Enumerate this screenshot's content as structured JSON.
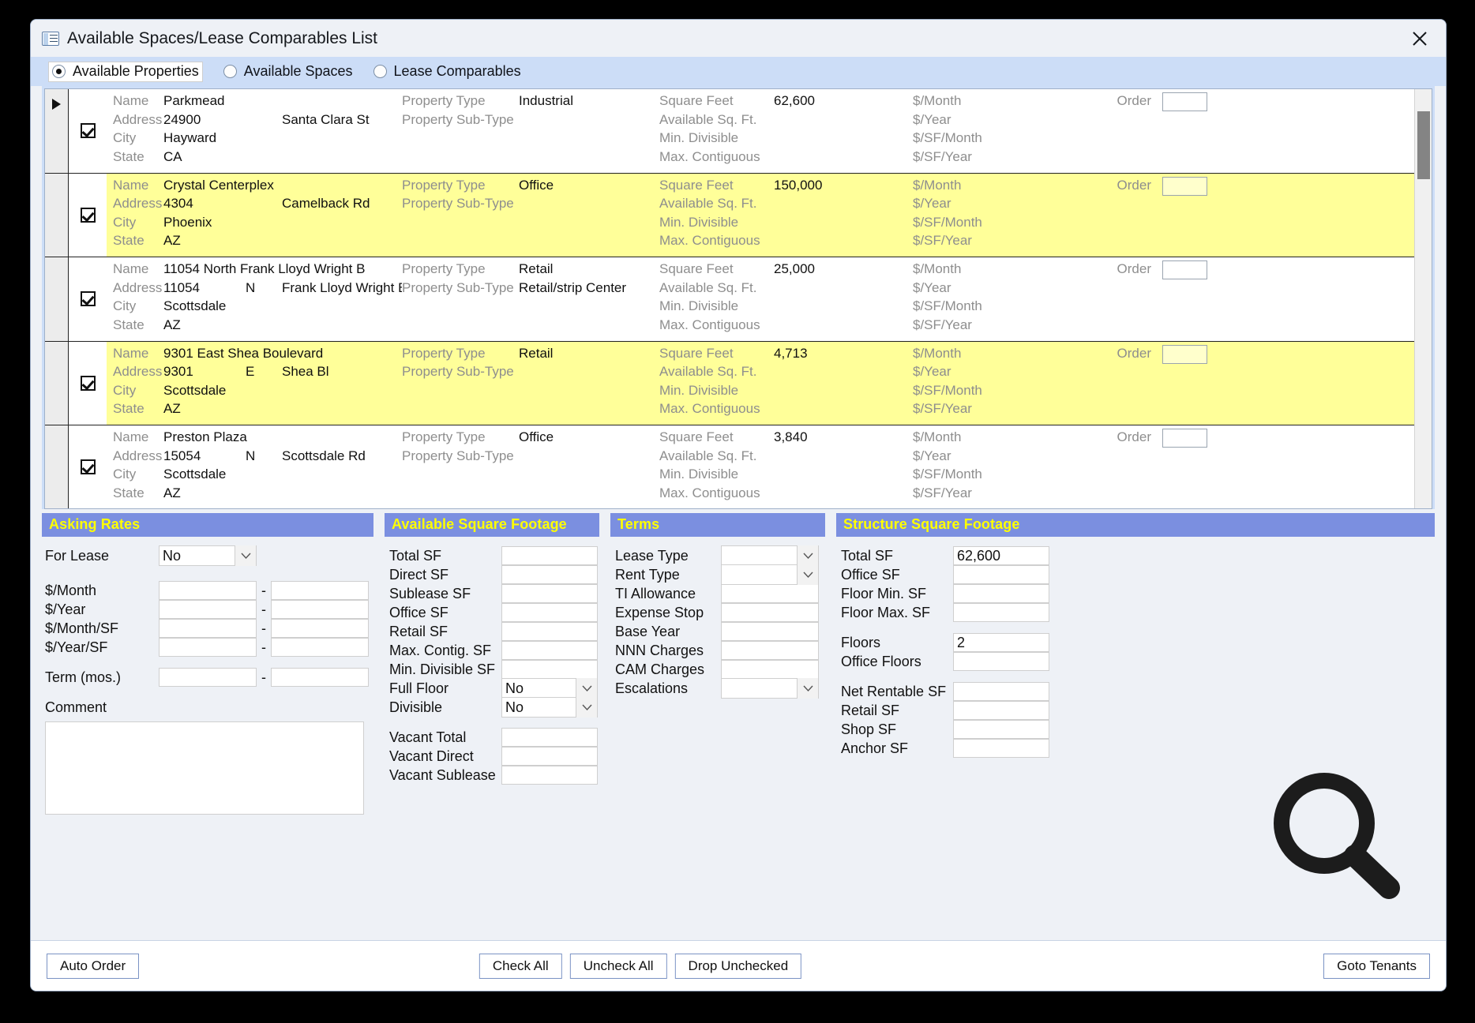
{
  "window": {
    "title": "Available Spaces/Lease Comparables List",
    "icon": "list-window-icon",
    "close_label": "✕"
  },
  "view_modes": {
    "options": [
      {
        "label": "Available Properties",
        "selected": true
      },
      {
        "label": "Available Spaces",
        "selected": false
      },
      {
        "label": "Lease Comparables",
        "selected": false
      }
    ]
  },
  "grid": {
    "field_labels": {
      "name": "Name",
      "address": "Address",
      "city": "City",
      "state": "State",
      "property_type": "Property Type",
      "property_sub_type": "Property Sub-Type",
      "square_feet": "Square Feet",
      "available_sq_ft": "Available Sq. Ft.",
      "min_divisible": "Min. Divisible",
      "max_contiguous": "Max. Contiguous",
      "per_month": "$/Month",
      "per_year": "$/Year",
      "per_sf_month": "$/SF/Month",
      "per_sf_year": "$/SF/Year",
      "order": "Order"
    },
    "rows": [
      {
        "current": true,
        "checked": true,
        "highlighted": false,
        "name": "Parkmead",
        "street_number": "24900",
        "street_dir": "",
        "street_name": "Santa Clara St",
        "city": "Hayward",
        "state": "CA",
        "property_type": "Industrial",
        "property_sub_type": "",
        "square_feet": "62,600",
        "available_sq_ft": "",
        "min_divisible": "",
        "max_contiguous": "",
        "per_month": "",
        "per_year": "",
        "per_sf_month": "",
        "per_sf_year": "",
        "order": ""
      },
      {
        "current": false,
        "checked": true,
        "highlighted": true,
        "name": "Crystal Centerplex",
        "street_number": "4304",
        "street_dir": "",
        "street_name": "Camelback Rd",
        "city": "Phoenix",
        "state": "AZ",
        "property_type": "Office",
        "property_sub_type": "",
        "square_feet": "150,000",
        "available_sq_ft": "",
        "min_divisible": "",
        "max_contiguous": "",
        "per_month": "",
        "per_year": "",
        "per_sf_month": "",
        "per_sf_year": "",
        "order": ""
      },
      {
        "current": false,
        "checked": true,
        "highlighted": false,
        "name": "11054 North Frank Lloyd Wright B",
        "street_number": "11054",
        "street_dir": "N",
        "street_name": "Frank Lloyd Wright B",
        "city": "Scottsdale",
        "state": "AZ",
        "property_type": "Retail",
        "property_sub_type": "Retail/strip Center",
        "square_feet": "25,000",
        "available_sq_ft": "",
        "min_divisible": "",
        "max_contiguous": "",
        "per_month": "",
        "per_year": "",
        "per_sf_month": "",
        "per_sf_year": "",
        "order": ""
      },
      {
        "current": false,
        "checked": true,
        "highlighted": true,
        "name": "9301 East Shea Boulevard",
        "street_number": "9301",
        "street_dir": "E",
        "street_name": "Shea Bl",
        "city": "Scottsdale",
        "state": "AZ",
        "property_type": "Retail",
        "property_sub_type": "",
        "square_feet": "4,713",
        "available_sq_ft": "",
        "min_divisible": "",
        "max_contiguous": "",
        "per_month": "",
        "per_year": "",
        "per_sf_month": "",
        "per_sf_year": "",
        "order": ""
      },
      {
        "current": false,
        "checked": true,
        "highlighted": false,
        "name": "Preston Plaza",
        "street_number": "15054",
        "street_dir": "N",
        "street_name": "Scottsdale Rd",
        "city": "Scottsdale",
        "state": "AZ",
        "property_type": "Office",
        "property_sub_type": "",
        "square_feet": "3,840",
        "available_sq_ft": "",
        "min_divisible": "",
        "max_contiguous": "",
        "per_month": "",
        "per_year": "",
        "per_sf_month": "",
        "per_sf_year": "",
        "order": ""
      }
    ]
  },
  "asking_rates": {
    "heading": "Asking Rates",
    "for_lease_label": "For Lease",
    "for_lease_value": "No",
    "per_month_label": "$/Month",
    "per_month_from": "",
    "per_month_to": "",
    "per_year_label": "$/Year",
    "per_year_from": "",
    "per_year_to": "",
    "per_month_sf_label": "$/Month/SF",
    "per_month_sf_from": "",
    "per_month_sf_to": "",
    "per_year_sf_label": "$/Year/SF",
    "per_year_sf_from": "",
    "per_year_sf_to": "",
    "term_label": "Term (mos.)",
    "term_from": "",
    "term_to": "",
    "comment_label": "Comment",
    "comment_value": "",
    "range_separator": "-"
  },
  "available_sf": {
    "heading": "Available Square Footage",
    "fields": [
      {
        "label": "Total SF",
        "value": "",
        "type": "text"
      },
      {
        "label": "Direct SF",
        "value": "",
        "type": "text"
      },
      {
        "label": "Sublease SF",
        "value": "",
        "type": "text"
      },
      {
        "label": "Office SF",
        "value": "",
        "type": "text"
      },
      {
        "label": "Retail SF",
        "value": "",
        "type": "text"
      },
      {
        "label": "Max. Contig. SF",
        "value": "",
        "type": "text"
      },
      {
        "label": "Min. Divisible SF",
        "value": "",
        "type": "text"
      },
      {
        "label": "Full Floor",
        "value": "No",
        "type": "select"
      },
      {
        "label": "Divisible",
        "value": "No",
        "type": "select"
      }
    ],
    "vacant_fields": [
      {
        "label": "Vacant Total",
        "value": "",
        "type": "text"
      },
      {
        "label": "Vacant Direct",
        "value": "",
        "type": "text"
      },
      {
        "label": "Vacant Sublease",
        "value": "",
        "type": "text"
      }
    ]
  },
  "terms": {
    "heading": "Terms",
    "fields": [
      {
        "label": "Lease Type",
        "value": "",
        "type": "select"
      },
      {
        "label": "Rent Type",
        "value": "",
        "type": "select"
      },
      {
        "label": "TI Allowance",
        "value": "",
        "type": "text"
      },
      {
        "label": "Expense Stop",
        "value": "",
        "type": "text"
      },
      {
        "label": "Base Year",
        "value": "",
        "type": "text"
      },
      {
        "label": "NNN Charges",
        "value": "",
        "type": "text"
      },
      {
        "label": "CAM Charges",
        "value": "",
        "type": "text"
      },
      {
        "label": "Escalations",
        "value": "",
        "type": "select"
      }
    ]
  },
  "structure_sf": {
    "heading": "Structure Square Footage",
    "group1": [
      {
        "label": "Total SF",
        "value": "62,600"
      },
      {
        "label": "Office SF",
        "value": ""
      },
      {
        "label": "Floor Min. SF",
        "value": ""
      },
      {
        "label": "Floor Max. SF",
        "value": ""
      }
    ],
    "group2": [
      {
        "label": "Floors",
        "value": "2"
      },
      {
        "label": "Office Floors",
        "value": ""
      }
    ],
    "group3": [
      {
        "label": "Net Rentable SF",
        "value": ""
      },
      {
        "label": "Retail SF",
        "value": ""
      },
      {
        "label": "Shop SF",
        "value": ""
      },
      {
        "label": "Anchor SF",
        "value": ""
      }
    ]
  },
  "footer": {
    "auto_order": "Auto Order",
    "check_all": "Check All",
    "uncheck_all": "Uncheck All",
    "drop_unchecked": "Drop Unchecked",
    "goto_tenants": "Goto Tenants"
  },
  "colors": {
    "highlight_row": "#ffff99",
    "panel_header_bg": "#7b8fe0",
    "panel_header_text": "#ffff00",
    "radiobar_bg": "#ccddf7"
  }
}
